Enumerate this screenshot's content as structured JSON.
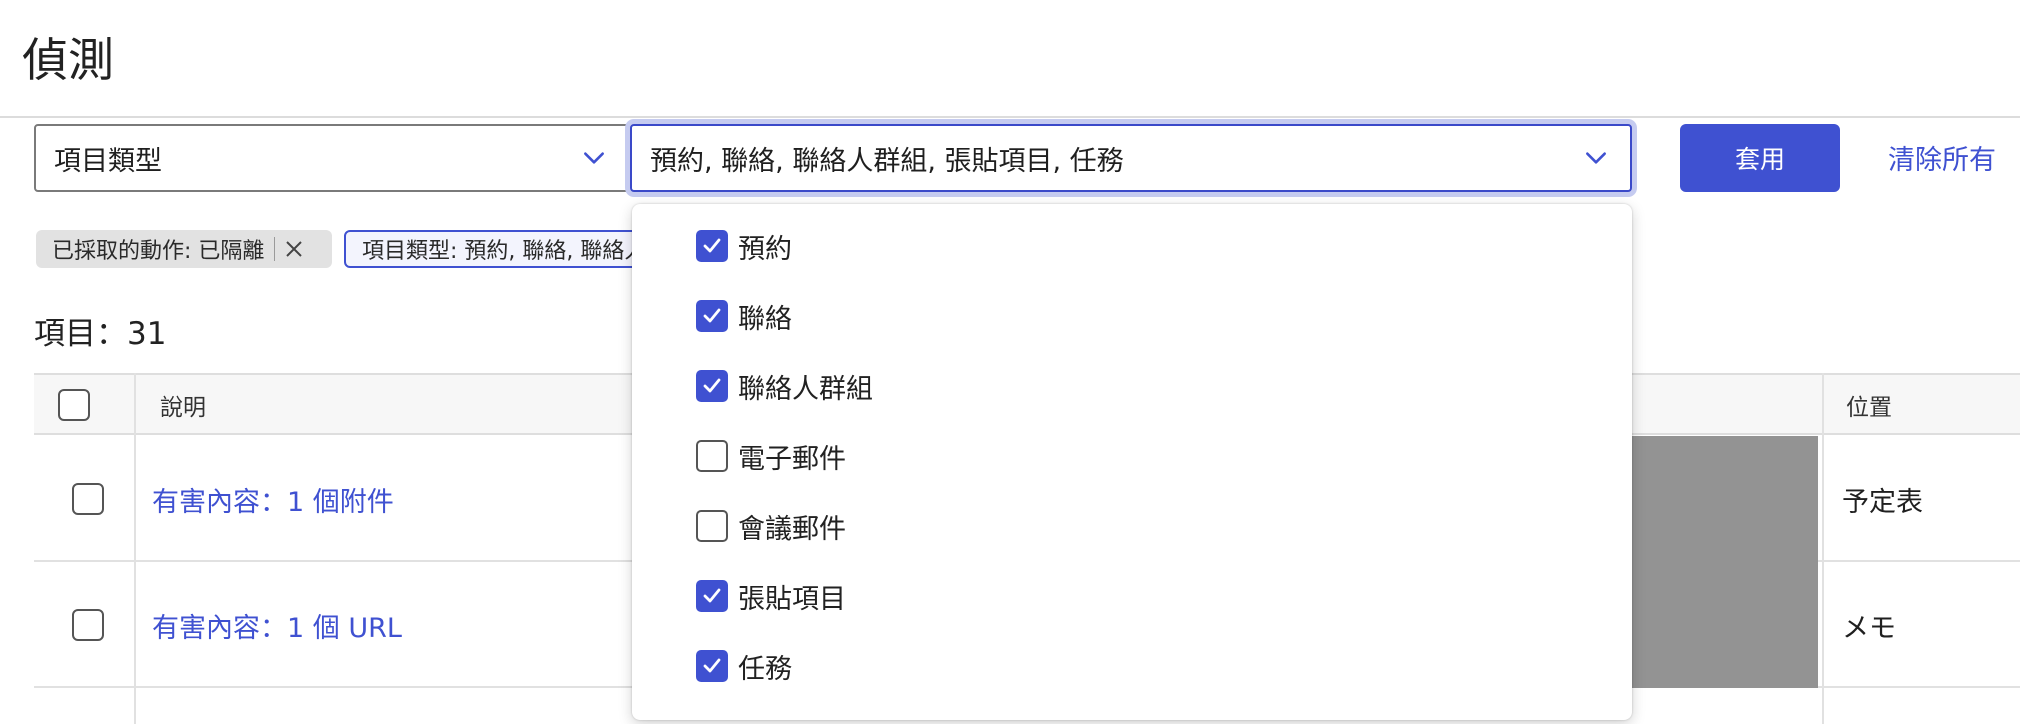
{
  "page": {
    "title": "偵測"
  },
  "filters": {
    "type_select": {
      "value": "項目類型"
    },
    "values_select": {
      "value": "預約, 聯絡, 聯絡人群組, 張貼項目, 任務"
    },
    "apply_label": "套用",
    "clear_label": "清除所有"
  },
  "chips": [
    {
      "label": "已採取的動作: 已隔離"
    },
    {
      "label": "項目類型: 預約, 聯絡, 聯絡人群組, 張貼項目, 任務"
    }
  ],
  "items": {
    "label": "項目：",
    "count": "31"
  },
  "table": {
    "headers": [
      "說明",
      "位置"
    ],
    "rows": [
      {
        "description": "有害內容：1 個附件",
        "location": "予定表"
      },
      {
        "description": "有害內容：1 個 URL",
        "location": "メモ"
      }
    ]
  },
  "dropdown": {
    "options": [
      {
        "label": "預約",
        "checked": true
      },
      {
        "label": "聯絡",
        "checked": true
      },
      {
        "label": "聯絡人群組",
        "checked": true
      },
      {
        "label": "電子郵件",
        "checked": false
      },
      {
        "label": "會議郵件",
        "checked": false
      },
      {
        "label": "張貼項目",
        "checked": true
      },
      {
        "label": "任務",
        "checked": true
      }
    ]
  },
  "icons": {
    "chevron": "chevron-down-icon",
    "close": "close-icon",
    "check": "checkmark-icon"
  },
  "colors": {
    "accent": "#3f51d1",
    "redacted": "#939393"
  }
}
